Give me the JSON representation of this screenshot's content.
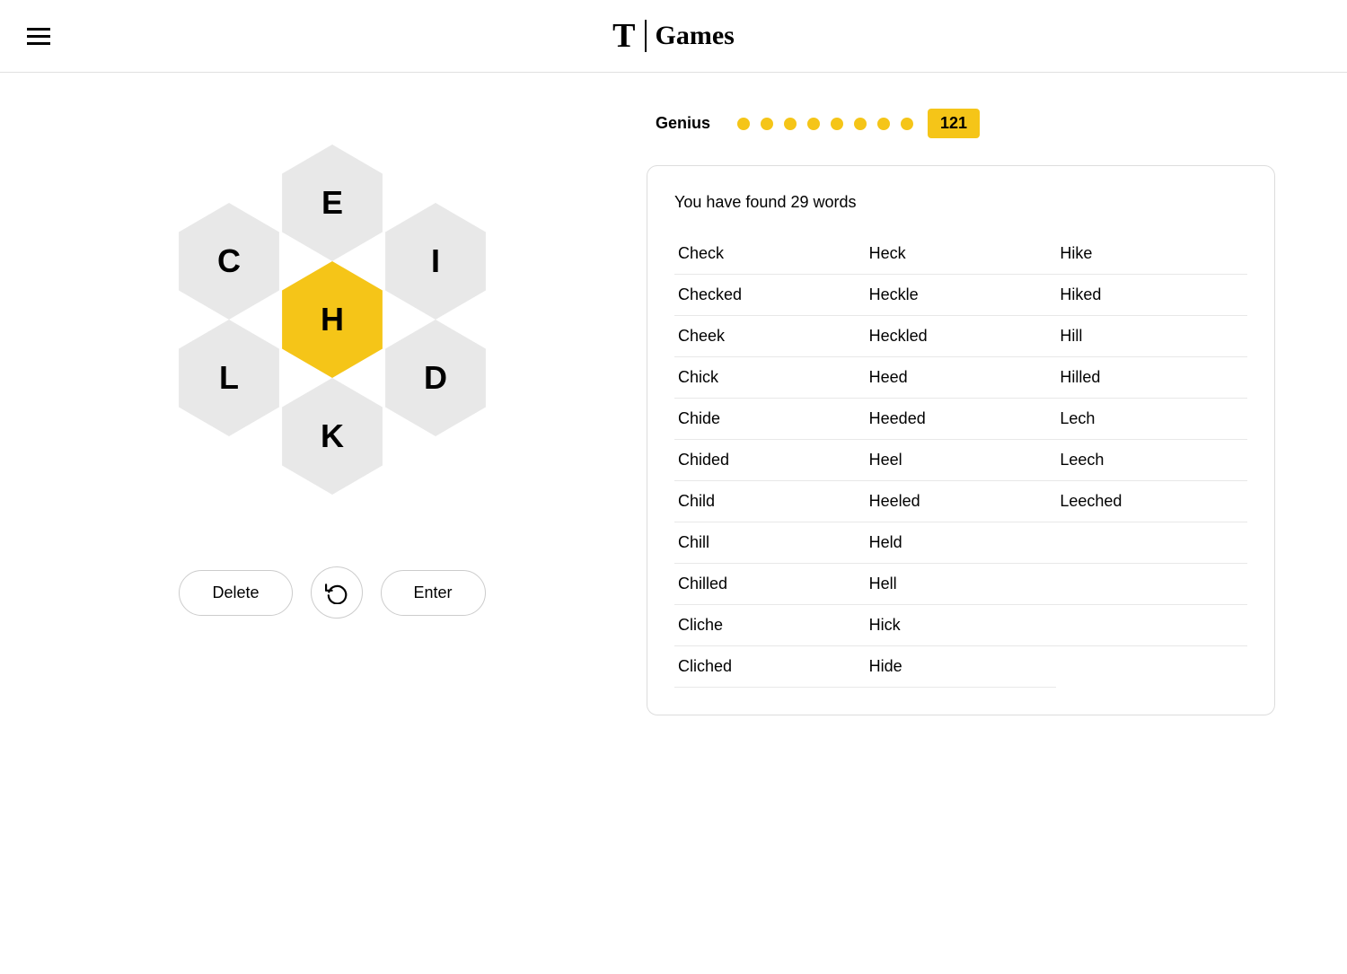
{
  "header": {
    "logo_t": "T",
    "divider": "|",
    "games_text": "Games",
    "menu_label": "Menu"
  },
  "score_bar": {
    "label": "Genius",
    "dots_filled": 8,
    "dots_empty": 0,
    "score": "121"
  },
  "honeycomb": {
    "center": {
      "letter": "H",
      "type": "yellow"
    },
    "top": {
      "letter": "E",
      "type": "gray"
    },
    "top_right": {
      "letter": "I",
      "type": "gray"
    },
    "bottom_right": {
      "letter": "D",
      "type": "gray"
    },
    "bottom": {
      "letter": "K",
      "type": "gray"
    },
    "bottom_left": {
      "letter": "L",
      "type": "gray"
    },
    "top_left": {
      "letter": "C",
      "type": "gray"
    }
  },
  "buttons": {
    "delete": "Delete",
    "shuffle": "↺",
    "enter": "Enter"
  },
  "words": {
    "found_count": "29",
    "found_label": "You have found 29 words",
    "col1": [
      "Check",
      "Checked",
      "Cheek",
      "Chick",
      "Chide",
      "Chided",
      "Child",
      "Chill",
      "Chilled",
      "Cliche",
      "Cliched"
    ],
    "col2": [
      "Heck",
      "Heckle",
      "Heckled",
      "Heed",
      "Heeded",
      "Heel",
      "Heeled",
      "Held",
      "Hell",
      "Hick",
      "Hide"
    ],
    "col3": [
      "Hike",
      "Hiked",
      "Hill",
      "Hilled",
      "Lech",
      "Leech",
      "Leeched",
      "",
      "",
      "",
      ""
    ]
  }
}
